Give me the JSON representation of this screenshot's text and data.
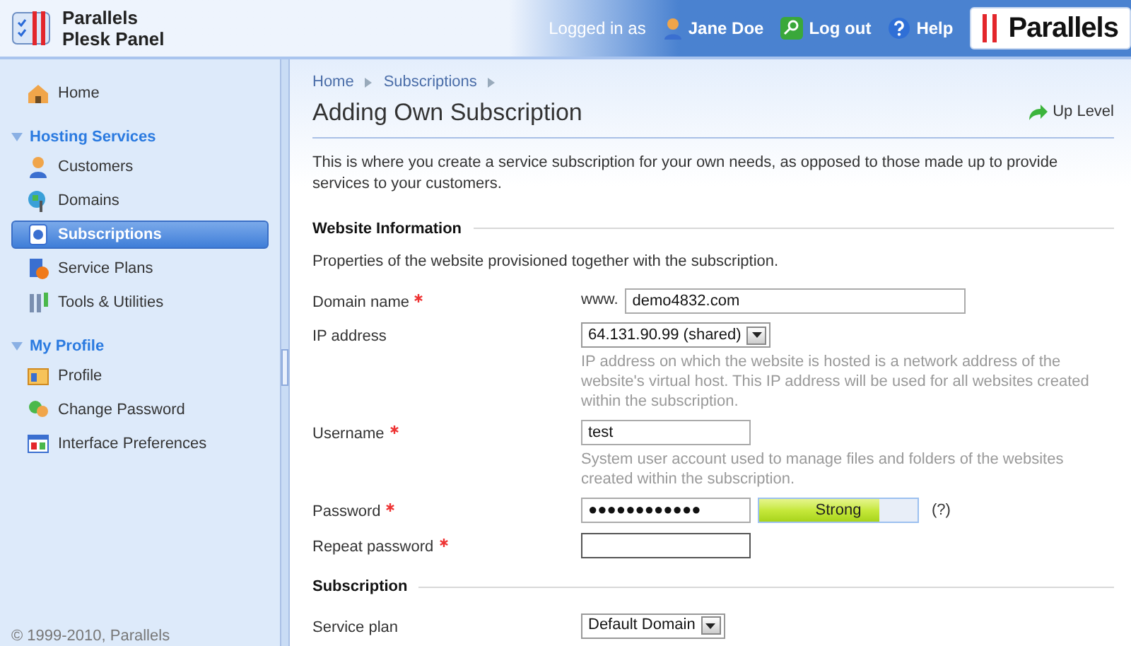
{
  "header": {
    "product_line1": "Parallels",
    "product_line2": "Plesk Panel",
    "logged_in_label": "Logged in as",
    "user": "Jane Doe",
    "logout": "Log out",
    "help": "Help",
    "brand": "Parallels"
  },
  "sidebar": {
    "items": [
      {
        "kind": "link",
        "label": "Home",
        "selected": false
      },
      {
        "kind": "group",
        "label": "Hosting Services",
        "expanded": true,
        "children": [
          {
            "label": "Customers",
            "selected": false
          },
          {
            "label": "Domains",
            "selected": false
          },
          {
            "label": "Subscriptions",
            "selected": true
          },
          {
            "label": "Service Plans",
            "selected": false
          },
          {
            "label": "Tools & Utilities",
            "selected": false
          }
        ]
      },
      {
        "kind": "group",
        "label": "My Profile",
        "expanded": true,
        "children": [
          {
            "label": "Profile",
            "selected": false
          },
          {
            "label": "Change Password",
            "selected": false
          },
          {
            "label": "Interface Preferences",
            "selected": false
          }
        ]
      }
    ],
    "copyright": "© 1999-2010, Parallels"
  },
  "breadcrumbs": [
    "Home",
    "Subscriptions"
  ],
  "page_title": "Adding Own Subscription",
  "up_level": "Up Level",
  "intro": "This is where you create a service subscription for your own needs, as opposed to those made up to provide services to your customers.",
  "sections": [
    {
      "title": "Website Information",
      "description": "Properties of the website provisioned together with the subscription.",
      "fields": [
        {
          "kind": "text",
          "label": "Domain name",
          "required": true,
          "prefix": "www.",
          "value": "demo4832.com",
          "focused": false
        },
        {
          "kind": "select",
          "label": "IP address",
          "required": false,
          "value": "64.131.90.99 (shared)",
          "hint": "IP address on which the website is hosted is a network address of the website's virtual host. This IP address will be used for all websites created within the subscription."
        },
        {
          "kind": "text",
          "label": "Username",
          "required": true,
          "value": "test",
          "hint": "System user account used to manage files and folders of the websites created within the subscription.",
          "focused": false
        },
        {
          "kind": "password",
          "label": "Password",
          "required": true,
          "value": "●●●●●●●●●●●●",
          "strength": {
            "label": "Strong",
            "level": 0.76
          },
          "help": "(?)",
          "focused": false
        },
        {
          "kind": "text",
          "label": "Repeat password",
          "required": true,
          "focused": true
        }
      ]
    },
    {
      "title": "Subscription",
      "fields": [
        {
          "kind": "select",
          "label": "Service plan",
          "required": false,
          "value": "Default Domain"
        }
      ]
    }
  ]
}
